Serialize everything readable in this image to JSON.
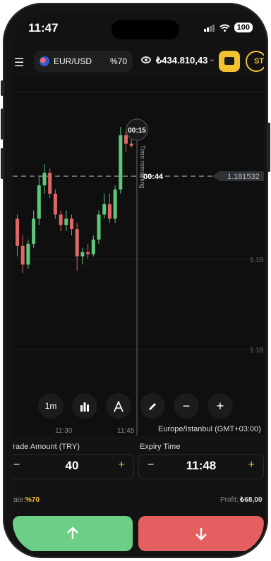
{
  "status": {
    "time": "11:47",
    "battery": "100"
  },
  "topbar": {
    "pair": "EUR/USD",
    "payout": "%70",
    "balance": "₺434.810,43",
    "avatar": "ST"
  },
  "chart": {
    "countdown": "00:15",
    "time_remaining_label": "Time remaining",
    "expiry_countdown": "00:44",
    "current_price": "1.181532",
    "price_levels": [
      "1.18",
      "1.18"
    ],
    "time_labels": [
      "11:30",
      "11:45"
    ],
    "timezone": "Europe/Istanbul (GMT+03:00)",
    "interval": "1m"
  },
  "chart_data": {
    "type": "candlestick",
    "current_price": 1.181532,
    "candles": [
      {
        "o": 0.58,
        "h": 0.6,
        "l": 0.4,
        "c": 0.45
      },
      {
        "o": 0.45,
        "h": 0.5,
        "l": 0.32,
        "c": 0.36
      },
      {
        "o": 0.36,
        "h": 0.48,
        "l": 0.34,
        "c": 0.46
      },
      {
        "o": 0.46,
        "h": 0.62,
        "l": 0.44,
        "c": 0.58
      },
      {
        "o": 0.58,
        "h": 0.78,
        "l": 0.55,
        "c": 0.74
      },
      {
        "o": 0.74,
        "h": 0.84,
        "l": 0.7,
        "c": 0.8
      },
      {
        "o": 0.8,
        "h": 0.82,
        "l": 0.68,
        "c": 0.7
      },
      {
        "o": 0.7,
        "h": 0.72,
        "l": 0.58,
        "c": 0.6
      },
      {
        "o": 0.6,
        "h": 0.62,
        "l": 0.52,
        "c": 0.55
      },
      {
        "o": 0.55,
        "h": 0.62,
        "l": 0.52,
        "c": 0.58
      },
      {
        "o": 0.58,
        "h": 0.6,
        "l": 0.5,
        "c": 0.53
      },
      {
        "o": 0.53,
        "h": 0.56,
        "l": 0.33,
        "c": 0.4
      },
      {
        "o": 0.4,
        "h": 0.44,
        "l": 0.36,
        "c": 0.42
      },
      {
        "o": 0.42,
        "h": 0.46,
        "l": 0.39,
        "c": 0.41
      },
      {
        "o": 0.41,
        "h": 0.5,
        "l": 0.4,
        "c": 0.48
      },
      {
        "o": 0.48,
        "h": 0.62,
        "l": 0.46,
        "c": 0.6
      },
      {
        "o": 0.6,
        "h": 0.7,
        "l": 0.58,
        "c": 0.65
      },
      {
        "o": 0.65,
        "h": 0.7,
        "l": 0.56,
        "c": 0.58
      },
      {
        "o": 0.58,
        "h": 0.74,
        "l": 0.56,
        "c": 0.72
      },
      {
        "o": 0.72,
        "h": 1.02,
        "l": 0.7,
        "c": 0.98
      },
      {
        "o": 0.98,
        "h": 1.0,
        "l": 0.9,
        "c": 0.94
      },
      {
        "o": 0.94,
        "h": 0.96,
        "l": 0.92,
        "c": 0.93
      }
    ]
  },
  "tools": [
    "1m",
    "candles-icon",
    "drawing-tool-icon",
    "pencil-icon",
    "−",
    "+"
  ],
  "trade": {
    "amount_label": "Trade Amount (TRY)",
    "amount_value": "40",
    "expiry_label": "Expiry Time",
    "expiry_value": "11:48",
    "rate_label": "Rate:",
    "rate_value": "%70",
    "profit_label": "Profit:",
    "profit_value": "₺68,00",
    "minus": "−",
    "plus": "+"
  },
  "colors": {
    "accent": "#f2c230",
    "up": "#6ccf85",
    "down": "#e46060",
    "candle_up": "#5ec77a",
    "candle_down": "#e26666"
  }
}
